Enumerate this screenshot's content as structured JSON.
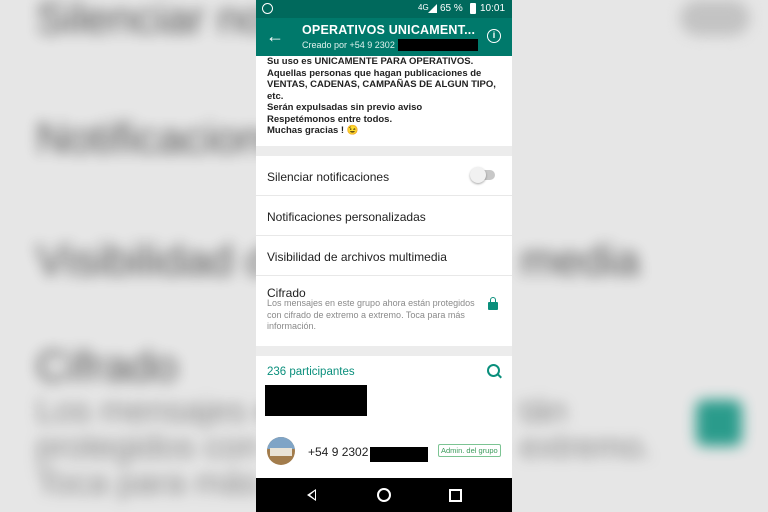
{
  "status_bar": {
    "network": "4G",
    "battery": "65 %",
    "time": "10:01"
  },
  "header": {
    "title": "OPERATIVOS UNICAMENT...",
    "subtitle": "Creado por +54 9 2302"
  },
  "description": [
    "Su uso es UNICAMENTE PARA OPERATIVOS.",
    "Aquellas personas que hagan publicaciones de",
    "VENTAS, CADENAS, CAMPAÑAS DE ALGUN TIPO,",
    "etc.",
    "Serán expulsadas sin previo aviso",
    "Respetémonos entre todos.",
    "Muchas gracias ! 😉"
  ],
  "settings": {
    "mute_label": "Silenciar notificaciones",
    "mute_enabled": false,
    "custom_notifications_label": "Notificaciones personalizadas",
    "media_visibility_label": "Visibilidad de archivos multimedia",
    "encryption_label": "Cifrado",
    "encryption_description": "Los mensajes en este grupo ahora están protegidos con cifrado de extremo a extremo. Toca para más información."
  },
  "participants": {
    "header": "236 participantes",
    "members": [
      {
        "phone": "+54 9 2302",
        "badge": "Admin. del grupo"
      }
    ]
  },
  "background": {
    "mute": "Silenciar notific",
    "custom": "Notificacionesp",
    "media": "Visibilidad de",
    "media_right": "media",
    "enc": "Cifrado",
    "enc_d1": "Los mensajes en",
    "enc_d1r": "tán",
    "enc_d2": "protegidos con c",
    "enc_d2r": "extremo.",
    "enc_d3": "Toca para más"
  },
  "colors": {
    "primary": "#00796b",
    "status_bar": "#00695c",
    "accent": "#0a8f7c",
    "admin_badge": "#3c9b5c"
  }
}
